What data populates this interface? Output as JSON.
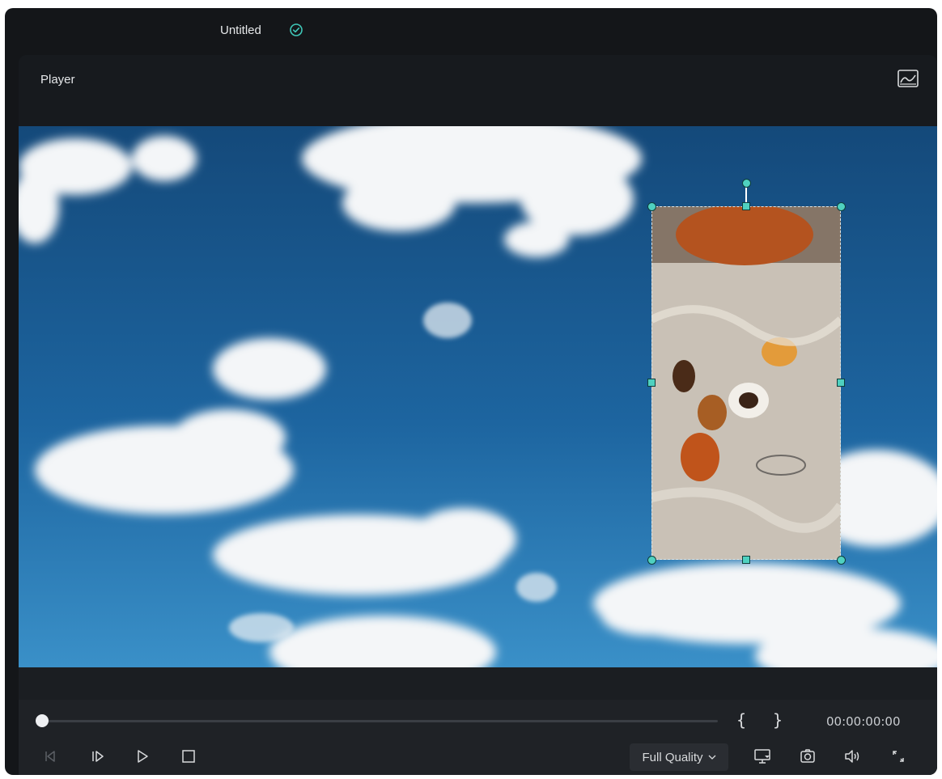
{
  "titlebar": {
    "title": "Untitled",
    "saved_icon": "check-circle-icon",
    "accent": "#3fc7b8"
  },
  "player": {
    "title": "Player",
    "scope_icon": "waveform-scope-icon",
    "preview": {
      "background": "blue sky with white clouds",
      "overlay": "cozy breakfast flatlay photo"
    }
  },
  "controls": {
    "progress": 0,
    "mark_in": "{",
    "mark_out": "}",
    "timecode": "00:00:00:00",
    "quality": "Full Quality",
    "buttons": [
      "previous-frame-icon",
      "next-frame-icon",
      "play-icon",
      "stop-icon",
      "display-icon",
      "snapshot-icon",
      "volume-icon",
      "fullscreen-icon"
    ]
  }
}
